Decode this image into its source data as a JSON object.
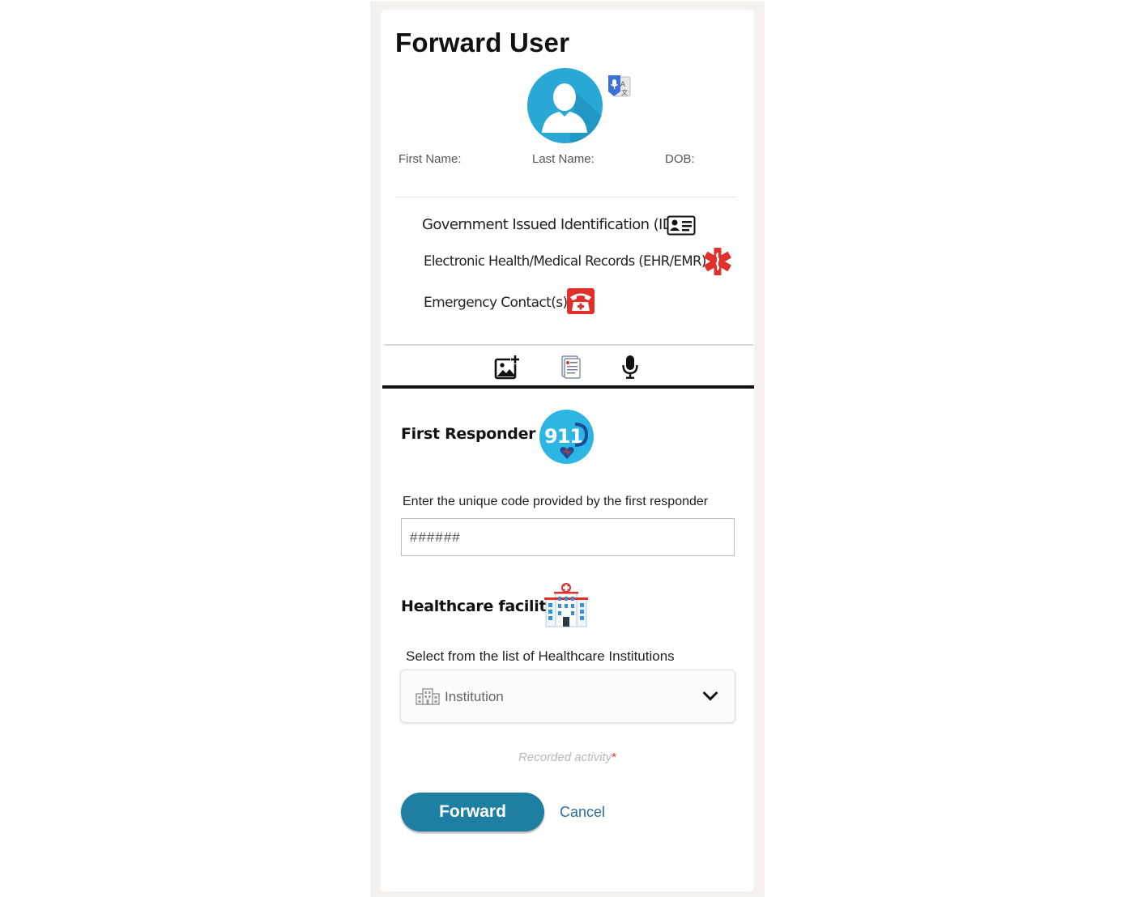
{
  "header": {
    "title": "Forward User"
  },
  "profile": {
    "first_name_label": "First Name:",
    "last_name_label": "Last Name:",
    "dob_label": "DOB:"
  },
  "records": [
    {
      "label": "Government Issued Identification (ID)",
      "icon": "id-card-icon"
    },
    {
      "label": "Electronic Health/Medical Records (EHR/EMR)",
      "icon": "medical-star-icon"
    },
    {
      "label": "Emergency Contact(s)",
      "icon": "emergency-phone-icon"
    }
  ],
  "toolbar": {
    "icons": [
      "add-photo-icon",
      "document-icon",
      "microphone-icon"
    ]
  },
  "first_responder": {
    "heading": "First Responder",
    "badge": "911",
    "hint": "Enter the unique code provided by the first responder",
    "placeholder": "######"
  },
  "healthcare": {
    "heading": "Healthcare facility",
    "hint": "Select from the list of Healthcare Institutions",
    "select_placeholder": "Institution"
  },
  "footer": {
    "recorded_activity": "Recorded activity",
    "required_mark": "*",
    "forward_label": "Forward",
    "cancel_label": "Cancel"
  },
  "colors": {
    "accent": "#1e7fa3",
    "avatar": "#29a8d6",
    "medical_red": "#e0302c",
    "link": "#2a6e9e"
  }
}
